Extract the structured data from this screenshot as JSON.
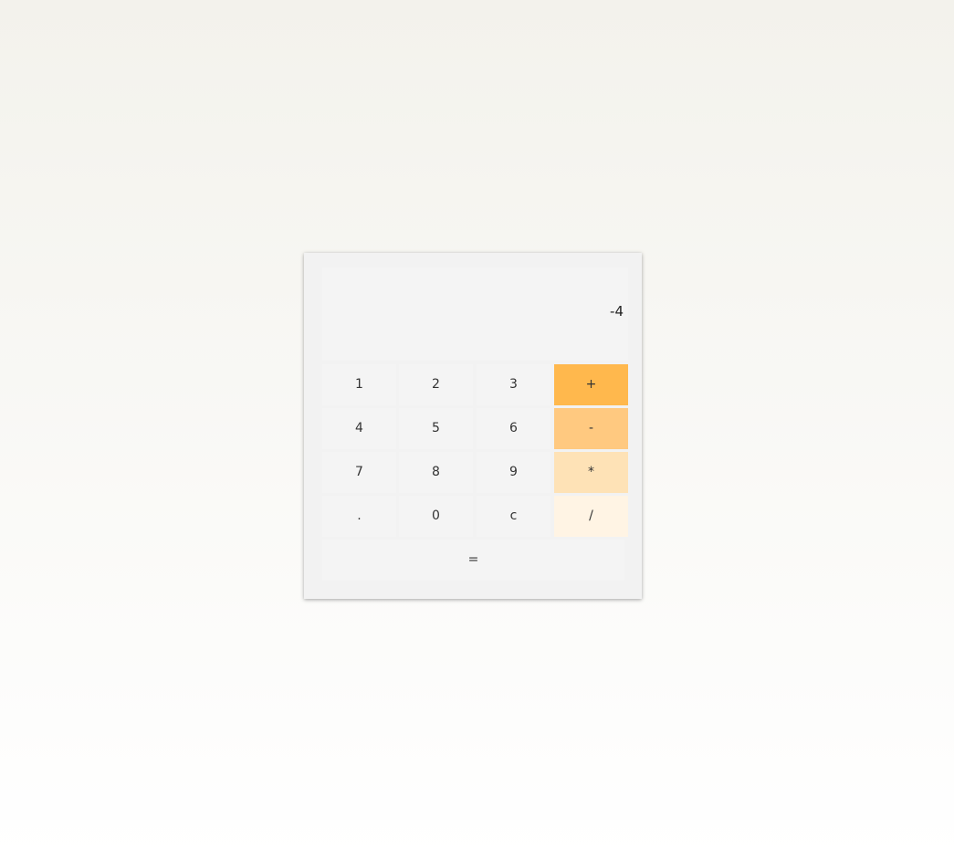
{
  "display": {
    "value": "-4"
  },
  "keys": {
    "one": "1",
    "two": "2",
    "three": "3",
    "plus": "+",
    "four": "4",
    "five": "5",
    "six": "6",
    "minus": "-",
    "seven": "7",
    "eight": "8",
    "nine": "9",
    "times": "*",
    "dot": ".",
    "zero": "0",
    "clear": "c",
    "divide": "/",
    "equals": "="
  },
  "colors": {
    "plus": "#ffb84d",
    "minus": "#ffc980",
    "times": "#fee2b6",
    "divide": "#fff4e4",
    "key": "#f4f4f4",
    "panel": "#f2f2f2"
  }
}
